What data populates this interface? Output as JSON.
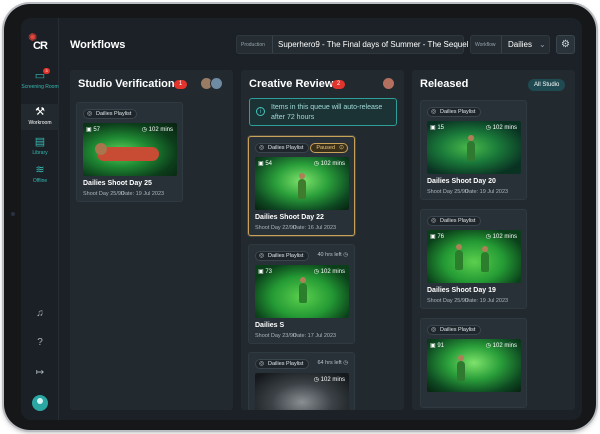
{
  "app": {
    "title": "Workflows",
    "logo_text": "CR",
    "accent": "#37b8b3",
    "alert": "#e0342c"
  },
  "sidebar": {
    "items": [
      {
        "label": "Screening Room",
        "icon": "monitor-icon",
        "badge": "3"
      },
      {
        "label": "Workroom",
        "icon": "workroom-icon"
      },
      {
        "label": "Library",
        "icon": "library-icon"
      },
      {
        "label": "Offline",
        "icon": "offline-icon"
      }
    ],
    "bottom": [
      {
        "icon": "bell-icon"
      },
      {
        "icon": "help-icon"
      },
      {
        "icon": "logout-icon"
      },
      {
        "icon": "user-avatar"
      }
    ]
  },
  "header": {
    "production_label": "Production",
    "production_value": "Superhero9 - The Final days of Summer - The Sequel",
    "workflow_label": "Workflow",
    "workflow_value": "Dailies"
  },
  "columns": {
    "studio": {
      "title": "Studio Verification",
      "count": "1",
      "cards": [
        {
          "tag": "Dailies Playlist",
          "shots": "57",
          "mins": "102 mins",
          "name": "Dailies Shoot Day 25",
          "shoot_day": "Shoot Day 25/90",
          "date": "Date: 19 Jul 2023"
        }
      ]
    },
    "creative": {
      "title": "Creative Review",
      "count": "2",
      "notice": "Items in this queue will auto-release after 72 hours",
      "cards": [
        {
          "tag": "Dailies Playlist",
          "status": "Paused",
          "shots": "54",
          "mins": "102 mins",
          "name": "Dailies Shoot Day 22",
          "shoot_day": "Shoot Day 22/90",
          "date": "Date: 16 Jul 2023"
        },
        {
          "tag": "Dailies Playlist",
          "time_left": "40 hrs left",
          "shots": "73",
          "mins": "102 mins",
          "name": "Dailies S",
          "shoot_day": "Shoot Day 23/90",
          "date": "Date: 17 Jul 2023"
        },
        {
          "tag": "Dailies Playlist",
          "time_left": "64 hrs left",
          "mins": "102 mins"
        }
      ]
    },
    "released": {
      "title": "Released",
      "filter": "All Studio",
      "cards": [
        {
          "tag": "Dailies Playlist",
          "shots": "15",
          "mins": "102 mins",
          "name": "Dailies Shoot Day 20",
          "shoot_day": "Shoot Day 25/90",
          "date": "Date: 19 Jul 2023"
        },
        {
          "tag": "Dailies Playlist",
          "shots": "76",
          "mins": "102 mins",
          "name": "Dailies Shoot Day 19",
          "shoot_day": "Shoot Day 25/90",
          "date": "Date: 19 Jul 2023"
        },
        {
          "tag": "Dailies Playlist",
          "shots": "91",
          "mins": "102 mins"
        }
      ]
    }
  }
}
